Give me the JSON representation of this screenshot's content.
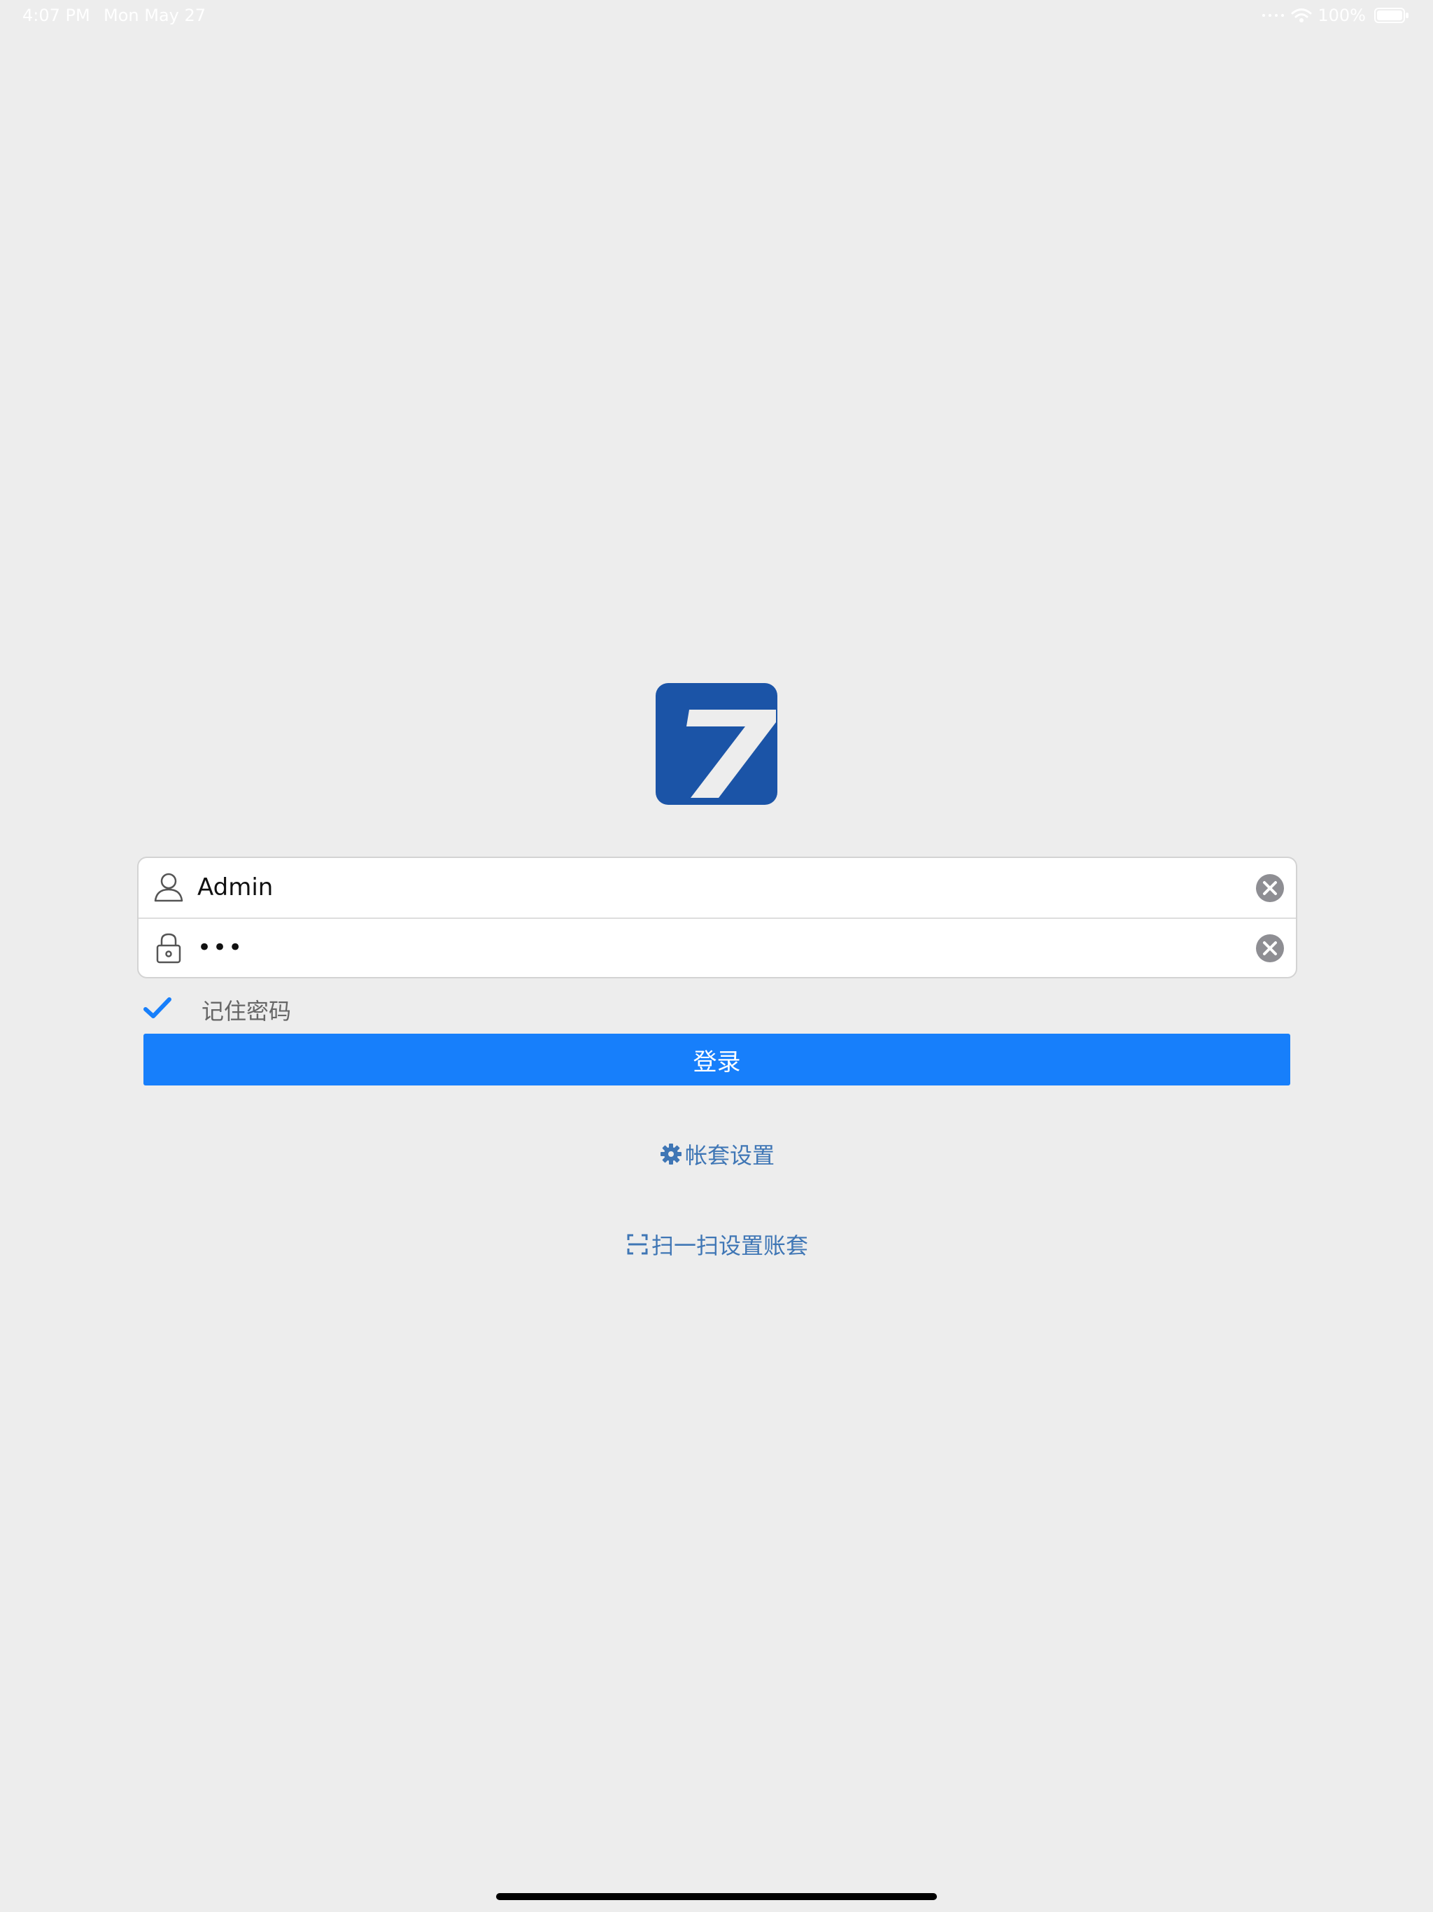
{
  "status_bar": {
    "time": "4:07 PM",
    "date": "Mon May 27",
    "battery": "100%",
    "icons": [
      "signal-dots-icon",
      "wifi-icon",
      "battery-icon"
    ]
  },
  "logo": {
    "icon": "app-logo-seven",
    "colors": {
      "background": "#1b54a7",
      "glyph": "#ededed"
    }
  },
  "login_form": {
    "username": {
      "value": "Admin",
      "icon": "user-icon",
      "clear_icon": "clear-icon"
    },
    "password": {
      "value": "•••",
      "icon": "lock-icon",
      "clear_icon": "clear-icon"
    },
    "remember": {
      "label": "记住密码",
      "checked": true,
      "icon": "checkmark-icon"
    },
    "submit_label": "登录"
  },
  "links": {
    "settings": {
      "label": "帐套设置",
      "icon": "gear-icon"
    },
    "scan": {
      "label": "扫一扫设置账套",
      "icon": "scan-icon"
    }
  },
  "colors": {
    "background": "#ededed",
    "primary_button": "#177ffb",
    "link": "#3f76b5",
    "check": "#177ffb"
  }
}
